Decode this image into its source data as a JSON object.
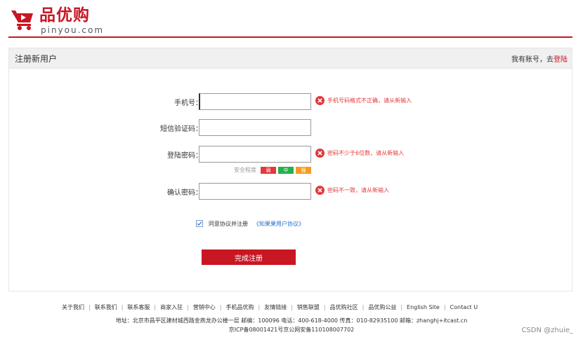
{
  "header": {
    "logo_text": "品优购",
    "logo_sub": "pinyou.com",
    "brand_color": "#c81623"
  },
  "panel": {
    "title": "注册新用户",
    "login_prompt": "我有账号，去",
    "login_link": "登陆"
  },
  "form": {
    "phone": {
      "label": "手机号：",
      "value": "",
      "error": "手机号码格式不正确，请从新输入"
    },
    "sms": {
      "label": "短信验证码：",
      "value": ""
    },
    "password": {
      "label": "登陆密码：",
      "value": "",
      "error": "密码不少于6位数，请从新输入"
    },
    "strength": {
      "label": "安全程度",
      "levels": [
        {
          "text": "弱",
          "color": "#e4393c"
        },
        {
          "text": "中",
          "color": "#22b14c"
        },
        {
          "text": "强",
          "color": "#f59a23"
        }
      ]
    },
    "confirm": {
      "label": "确认密码：",
      "value": "",
      "error": "密码不一致，请从新输入"
    },
    "agree_text": "同意协议并注册",
    "agree_link": "《知果果用户协议》",
    "agree_checked": true,
    "submit_label": "完成注册"
  },
  "footer": {
    "links": [
      "关于我们",
      "联系我们",
      "联系客服",
      "商家入驻",
      "营销中心",
      "手机品优购",
      "友情链接",
      "销售联盟",
      "品优购社区",
      "品优购公益",
      "English Site",
      "Contact U"
    ],
    "address": "地址：北京市昌平区建材城西路金燕龙办公楼一层 邮编：100096 电话：400-618-4000 传真：010-82935100 邮箱：zhanghj+itcast.cn",
    "icp": "京ICP备08001421号京公网安备110108007702"
  },
  "watermark": "CSDN @zhuie_",
  "colors": {
    "error": "#e4393c",
    "link": "#2a6ec9"
  }
}
